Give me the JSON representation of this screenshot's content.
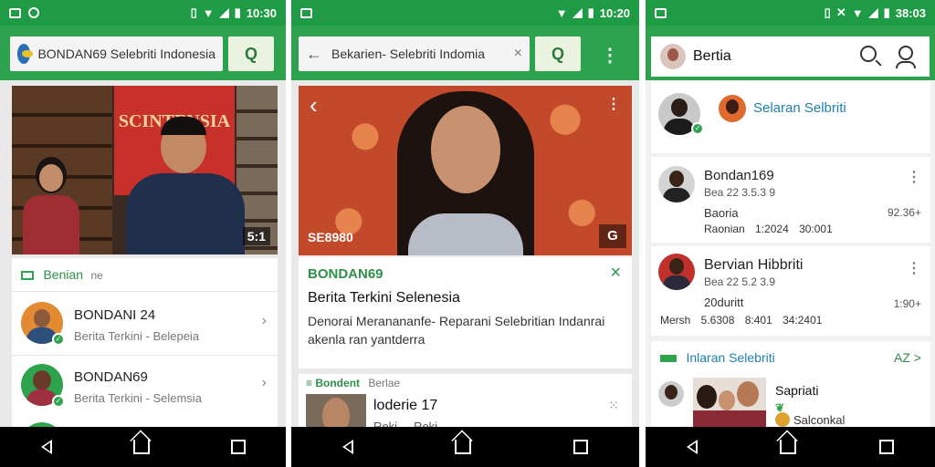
{
  "phone1": {
    "status": {
      "time": "10:30"
    },
    "search": {
      "text": "BONDAN69 Selebriti Indonesia",
      "button": "Q"
    },
    "video": {
      "banner": "SCINTENSIA",
      "duration": "5:1"
    },
    "section": {
      "label": "Benian",
      "sub": "ne"
    },
    "items": [
      {
        "title": "BONDANI 24",
        "subtitle": "Berita Terkini - Belepeia"
      },
      {
        "title": "BONDAN69",
        "subtitle": "Berita Terkini - Selemsia"
      }
    ]
  },
  "phone2": {
    "status": {
      "time": "10:20"
    },
    "search": {
      "text": "Bekarien- Selebriti Indomia",
      "clear": "×",
      "button": "Q",
      "menu": "⋮"
    },
    "video": {
      "caption": "SE8980",
      "back": "‹",
      "more": "⋮"
    },
    "article": {
      "tag": "BONDAN69",
      "title": "Berita Terkini Selenesia",
      "body": "Denorai Meranananfe- Reparani Selebritian Indanrai akenla ran yantderra",
      "close": "×"
    },
    "next": {
      "tag": "Bondent",
      "tag2": "Berlae",
      "title": "loderie 17",
      "sub": "Reki ... Reki"
    }
  },
  "phone3": {
    "status": {
      "time": "38:03"
    },
    "header": {
      "title": "Bertia"
    },
    "top": {
      "link": "Selaran Selbriti"
    },
    "items": [
      {
        "title": "Bondan169",
        "line1": "Bea 22 3.5.3 9",
        "line2": "Baoria",
        "line3": "Raonian  1:2024  30:001",
        "right": "92.36+"
      },
      {
        "title": "Bervian Hibbriti",
        "line1": "Bea 22 5.2 3.9",
        "line2": "20duritt",
        "line3": "Mersh  5.6308  8:401  34:2401",
        "right": "1:90+"
      }
    ],
    "section": {
      "label": "Inlaran Selebriti",
      "right": "AZ >"
    },
    "bottom": {
      "title": "Sapriati",
      "sub": "Salconkal"
    }
  }
}
